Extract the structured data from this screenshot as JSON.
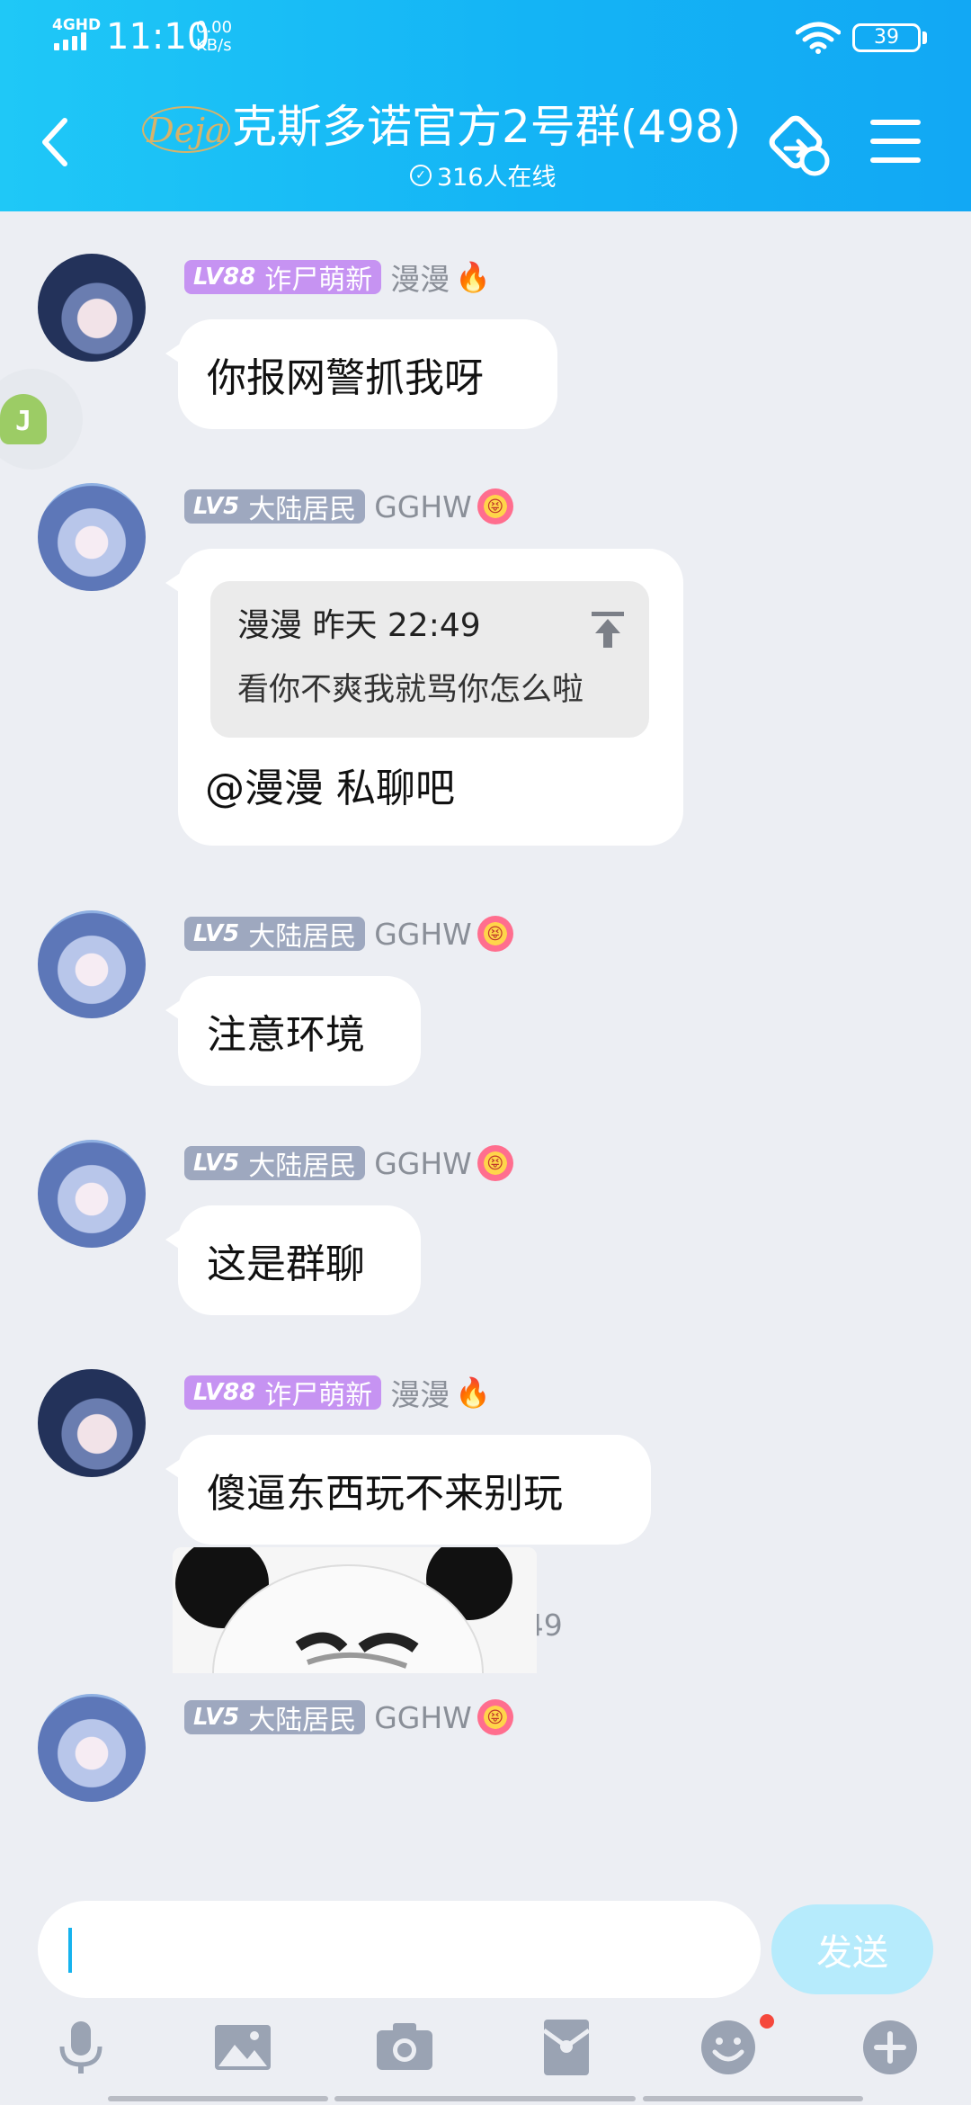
{
  "status_bar": {
    "network": "4GHD",
    "time": "11:10",
    "speed_value": "0.00",
    "speed_unit": "KB/s",
    "battery": "39"
  },
  "header": {
    "logo_text": "Deja",
    "title": "克斯多诺官方2号群(498)",
    "online": "316人在线"
  },
  "messages": [
    {
      "badge_level": "LV88",
      "badge_title": "诈尸萌新",
      "sender": "漫漫",
      "emoji": "🔥",
      "text": "你报网警抓我呀"
    },
    {
      "badge_level": "LV5",
      "badge_title": "大陆居民",
      "sender": "GGHW",
      "emoji": "😝",
      "quote_header": "漫漫  昨天 22:49",
      "quote_text": "看你不爽我就骂你怎么啦",
      "text": "@漫漫 私聊吧"
    },
    {
      "badge_level": "LV5",
      "badge_title": "大陆居民",
      "sender": "GGHW",
      "emoji": "😝",
      "text": "注意环境"
    },
    {
      "badge_level": "LV5",
      "badge_title": "大陆居民",
      "sender": "GGHW",
      "emoji": "😝",
      "text": "这是群聊"
    },
    {
      "badge_level": "LV88",
      "badge_title": "诈尸萌新",
      "sender": "漫漫",
      "emoji": "🔥",
      "text": "傻逼东西玩不来别玩"
    },
    {
      "badge_level": "LV5",
      "badge_title": "大陆居民",
      "sender": "GGHW",
      "emoji": "😝",
      "text": ""
    }
  ],
  "time_divider": "昨天 22:49",
  "floating_ball_label": "J",
  "input": {
    "value": "",
    "send_label": "发送"
  },
  "toolbar": {
    "icons": [
      "microphone-icon",
      "image-icon",
      "camera-icon",
      "red-packet-icon",
      "emoji-icon",
      "plus-icon"
    ],
    "emoji_has_badge": true
  },
  "colors": {
    "header": "#14b4f5",
    "lv88_badge": "#c693f2",
    "lv5_badge": "#9ea8bf",
    "send_button": "#b6ebfc",
    "background": "#eceef3"
  }
}
